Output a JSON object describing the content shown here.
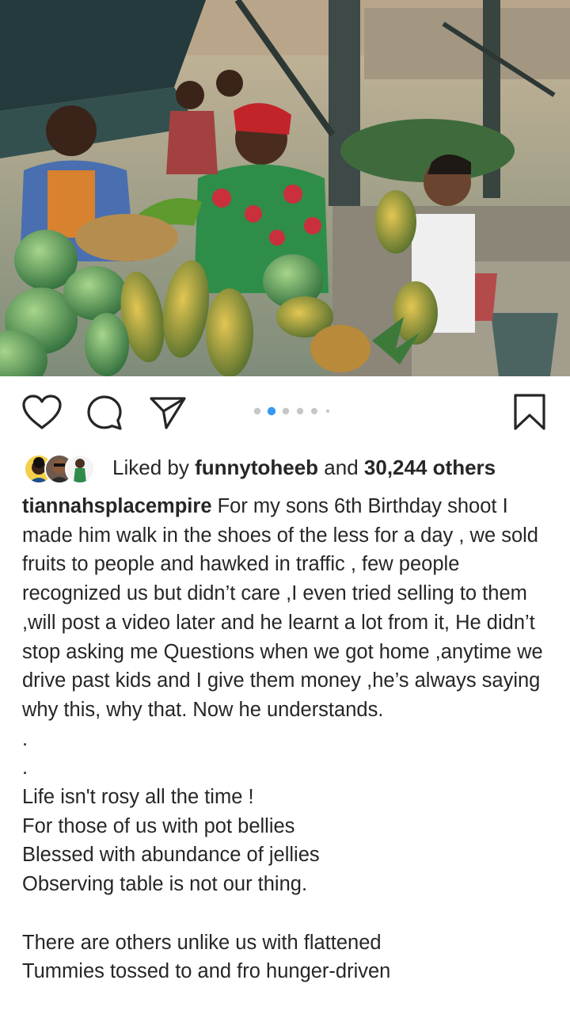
{
  "post": {
    "photo_description": "market-photo",
    "carousel": {
      "count": 6,
      "active_index": 1
    },
    "likes": {
      "prefix": "Liked by ",
      "first_liker": "funnytoheeb",
      "middle": " and ",
      "others": "30,244 others"
    },
    "caption": {
      "username": "tiannahsplacempire",
      "text": " For my sons 6th Birthday shoot I made him walk in the shoes of the less for a day , we sold fruits to people and hawked in traffic , few people recognized us but didn’t care ,I even tried selling to them ,will post a video later and he learnt a lot from it, He didn’t stop asking me Questions when we got home ,anytime we drive past kids and I give them money ,he’s always saying why this, why that. Now he understands.\n.\n.\nLife isn't rosy all the time !\nFor those of us with pot bellies\nBlessed with abundance of jellies\nObserving table is not our thing.\n\nThere are others unlike us with flattened\nTummies tossed to and fro hunger-driven"
    },
    "icons": {
      "like": "heart-icon",
      "comment": "comment-bubble-icon",
      "share": "paper-plane-icon",
      "save": "bookmark-icon"
    },
    "colors": {
      "active_dot": "#3897f0",
      "inactive_dot": "#c7c7c7",
      "text": "#262626"
    }
  }
}
